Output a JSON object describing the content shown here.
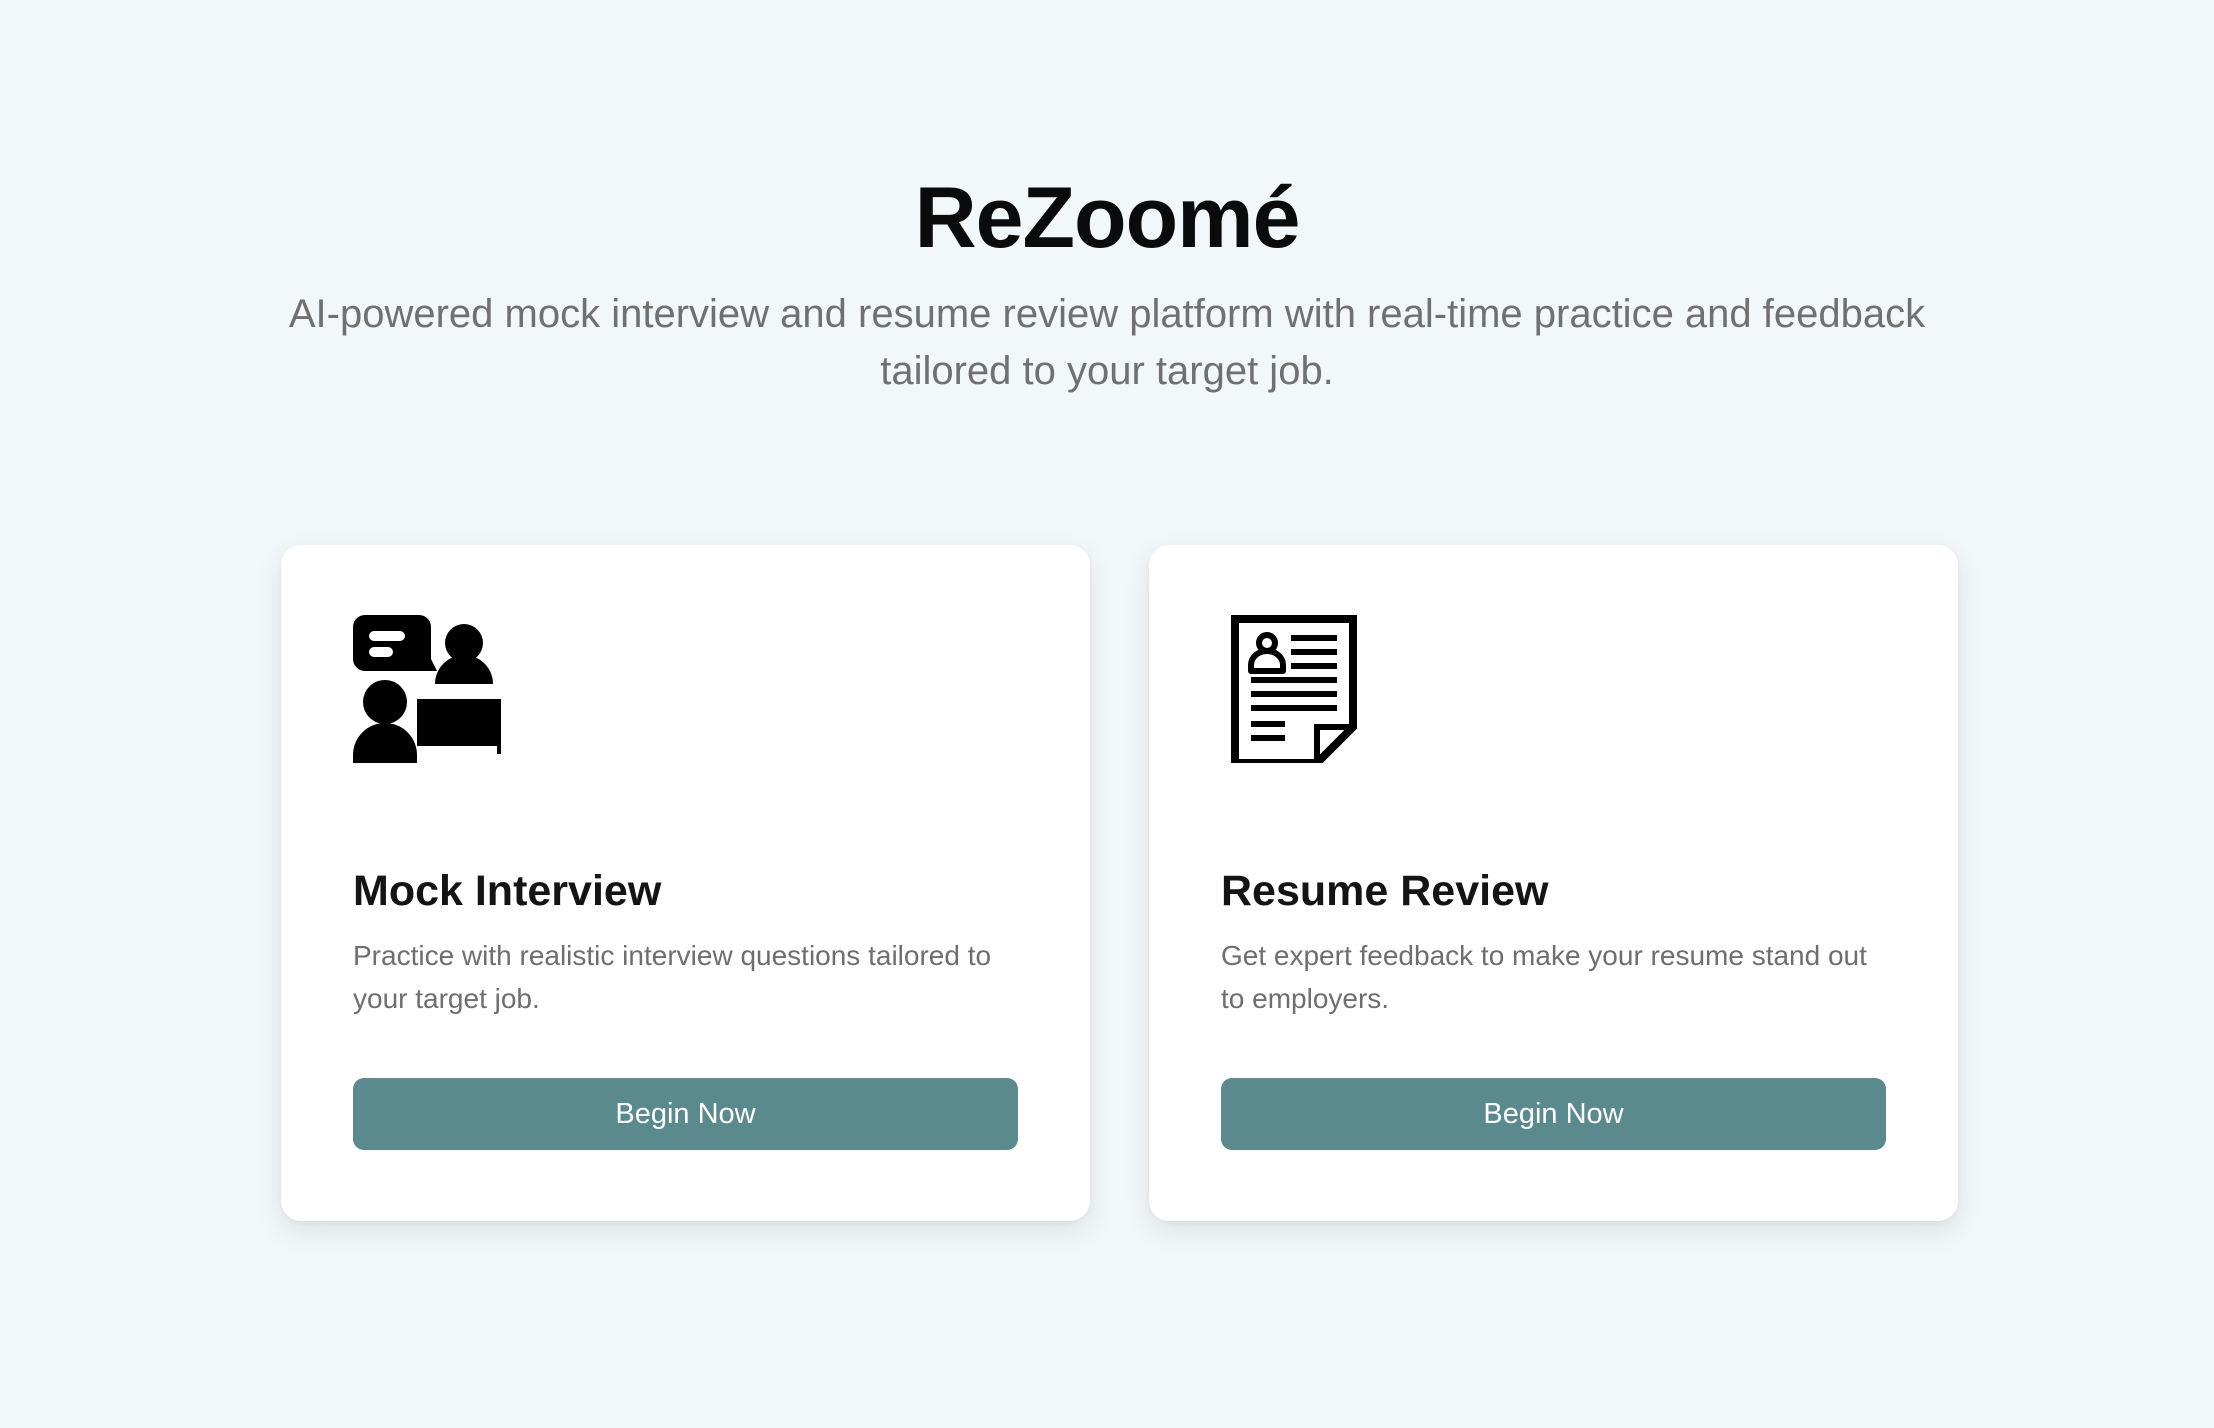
{
  "header": {
    "title": "ReZoomé",
    "subtitle": "AI-powered mock interview and resume review platform with real-time practice and feedback tailored to your target job."
  },
  "cards": [
    {
      "icon": "interview-icon",
      "title": "Mock Interview",
      "description": "Practice with realistic interview questions tailored to your target job.",
      "button_label": "Begin Now"
    },
    {
      "icon": "resume-document-icon",
      "title": "Resume Review",
      "description": "Get expert feedback to make your resume stand out to employers.",
      "button_label": "Begin Now"
    }
  ],
  "colors": {
    "background": "#f2f7f9",
    "card": "#ffffff",
    "button": "#5a8a8d",
    "button_text": "#ffffff",
    "heading": "#111111",
    "muted_text": "#707070"
  }
}
